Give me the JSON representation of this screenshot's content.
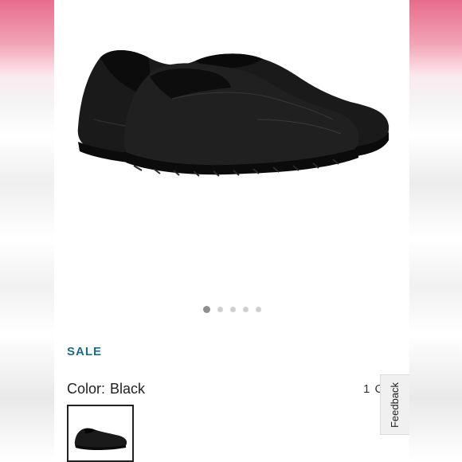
{
  "product": {
    "sale_label": "SALE",
    "color_label": "Color:",
    "color_value": "Black",
    "colors_count_text": "1 C"
  },
  "carousel": {
    "total_slides": 5,
    "active_slide": 1
  },
  "feedback": {
    "label": "Feedback"
  },
  "colors": {
    "sale": "#1b6b8a",
    "band_pink": "#e86c8b"
  }
}
